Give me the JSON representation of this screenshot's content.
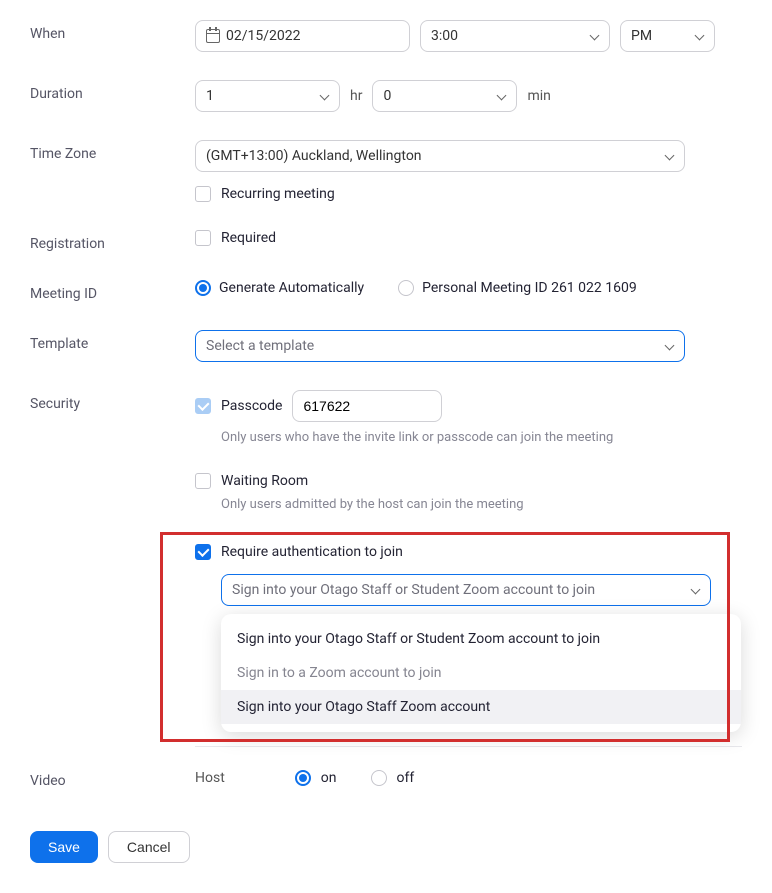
{
  "labels": {
    "when": "When",
    "duration": "Duration",
    "time_zone": "Time Zone",
    "registration": "Registration",
    "meeting_id": "Meeting ID",
    "template": "Template",
    "security": "Security",
    "video": "Video"
  },
  "when": {
    "date": "02/15/2022",
    "time": "3:00",
    "ampm": "PM"
  },
  "duration": {
    "hours": "1",
    "hr_unit": "hr",
    "minutes": "0",
    "min_unit": "min"
  },
  "timezone": {
    "value": "(GMT+13:00) Auckland, Wellington"
  },
  "recurring": {
    "label": "Recurring meeting"
  },
  "registration": {
    "required_label": "Required"
  },
  "meeting_id": {
    "auto_label": "Generate Automatically",
    "personal_label": "Personal Meeting ID 261 022 1609"
  },
  "template": {
    "placeholder": "Select a template"
  },
  "security": {
    "passcode_label": "Passcode",
    "passcode_value": "617622",
    "passcode_helper": "Only users who have the invite link or passcode can join the meeting",
    "waiting_label": "Waiting Room",
    "waiting_helper": "Only users admitted by the host can join the meeting",
    "auth_label": "Require authentication to join",
    "auth_selected": "Sign into your Otago Staff or Student Zoom account to join",
    "auth_options": [
      "Sign into your Otago Staff or Student Zoom account to join",
      "Sign in to a Zoom account to join",
      "Sign into your Otago Staff Zoom account"
    ]
  },
  "video": {
    "host_label": "Host",
    "on_label": "on",
    "off_label": "off"
  },
  "actions": {
    "save": "Save",
    "cancel": "Cancel"
  }
}
